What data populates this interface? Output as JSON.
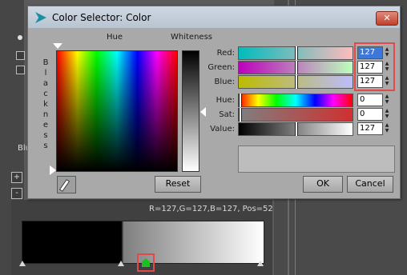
{
  "dialog": {
    "title": "Color Selector: Color",
    "close_icon": "close-icon"
  },
  "labels": {
    "hue": "Hue",
    "whiteness": "Whiteness",
    "blackness": [
      "B",
      "l",
      "a",
      "c",
      "k",
      "n",
      "e",
      "s",
      "s"
    ]
  },
  "rgb": {
    "red_label": "Red:",
    "green_label": "Green:",
    "blue_label": "Blue:",
    "red": "127",
    "green": "127",
    "blue": "127"
  },
  "hsv": {
    "hue_label": "Hue:",
    "sat_label": "Sat:",
    "value_label": "Value:",
    "hue": "0",
    "sat": "0",
    "value": "127"
  },
  "buttons": {
    "reset": "Reset",
    "ok": "OK",
    "cancel": "Cancel"
  },
  "background": {
    "left_text": "Blu",
    "gradient_readout": "R=127,G=127,B=127, Pos=52"
  },
  "colors": {
    "preview": "#bdbdbd",
    "highlight": "#e24a4a",
    "selected_marker": "#1fbf1f"
  }
}
